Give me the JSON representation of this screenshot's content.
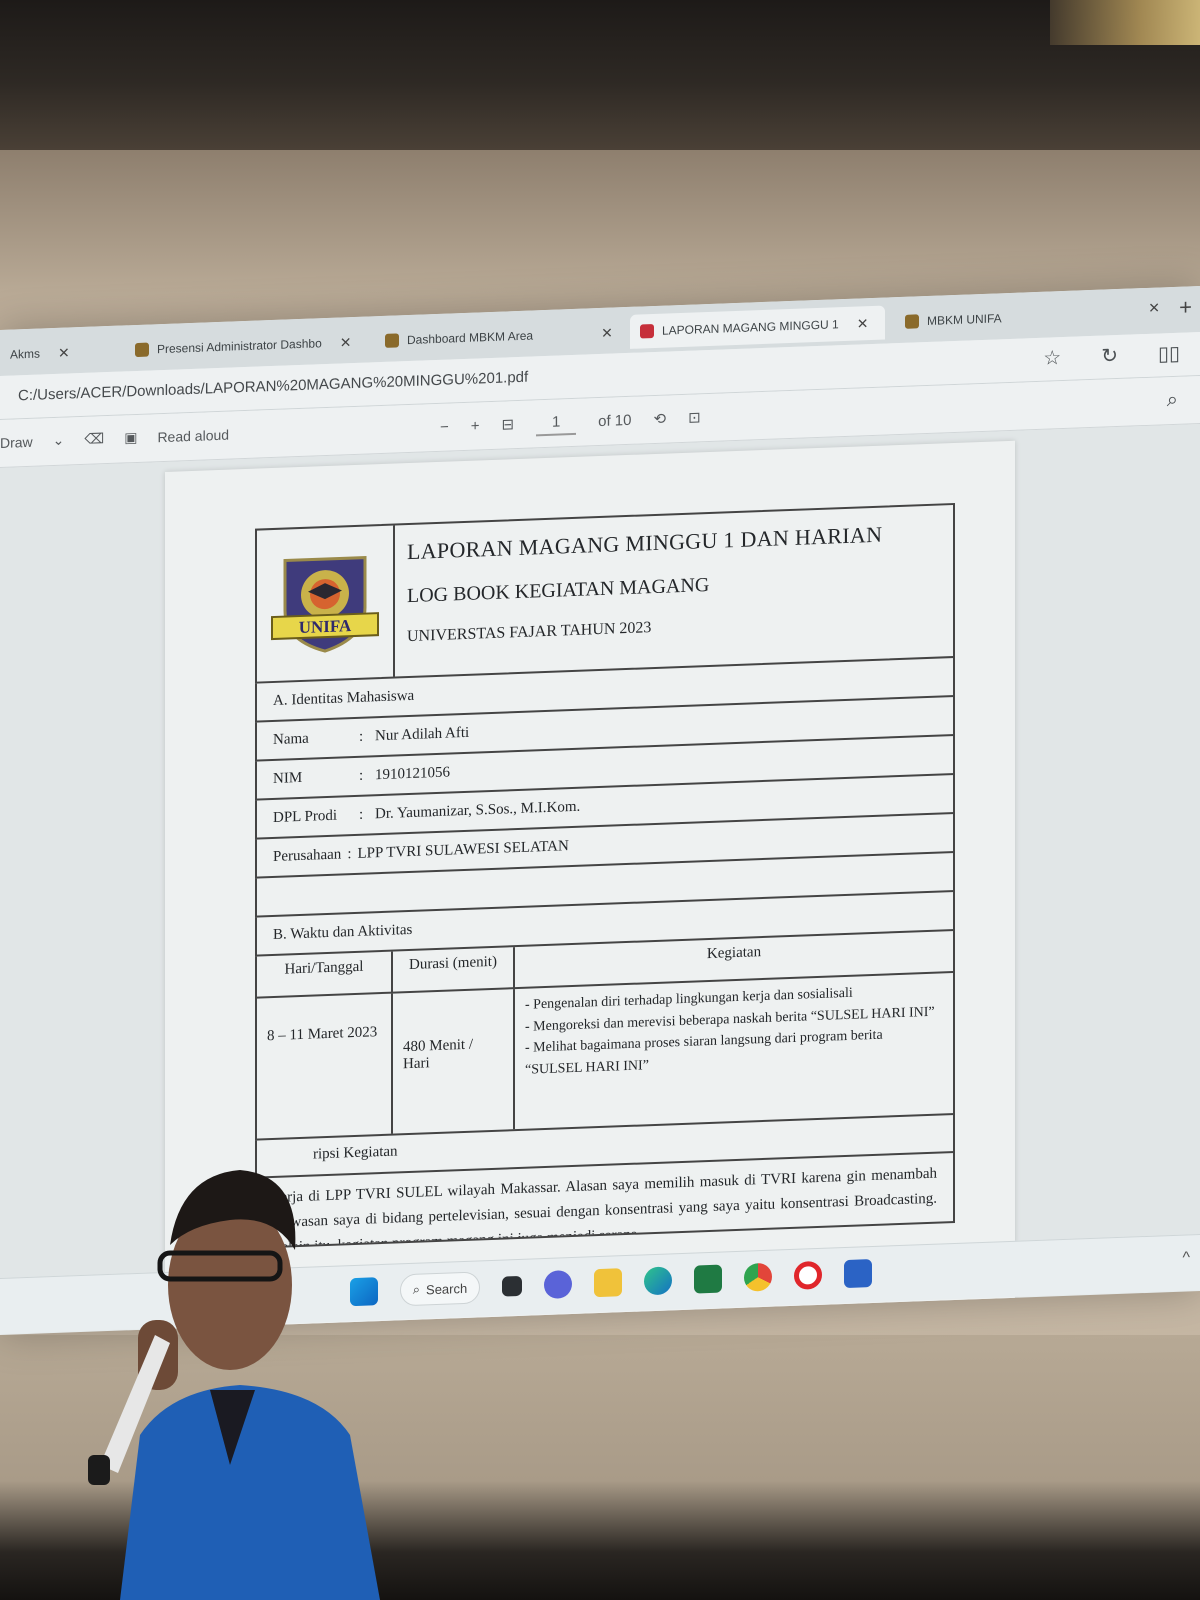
{
  "browser": {
    "tabs": [
      {
        "label": "Akms",
        "active": false
      },
      {
        "label": "Presensi Administrator Dashbo",
        "active": false
      },
      {
        "label": "Dashboard MBKM Area",
        "active": false
      },
      {
        "label": "LAPORAN MAGANG MINGGU 1",
        "active": true
      },
      {
        "label": "MBKM UNIFA",
        "active": false
      }
    ],
    "url": "C:/Users/ACER/Downloads/LAPORAN%20MAGANG%20MINGGU%201.pdf"
  },
  "pdf_toolbar": {
    "draw_label": "Draw",
    "read_aloud_label": "Read aloud",
    "zoom_out": "−",
    "zoom_in": "+",
    "page_current": "1",
    "page_total": "of 10"
  },
  "document": {
    "header": {
      "logo_text": "UNIFA",
      "title": "LAPORAN MAGANG MINGGU 1 DAN HARIAN",
      "subtitle": "LOG BOOK KEGIATAN MAGANG",
      "university": "UNIVERSTAS FAJAR TAHUN 2023"
    },
    "section_a": "A. Identitas Mahasiswa",
    "identity": [
      {
        "label": "Nama",
        "value": "Nur Adilah Afti"
      },
      {
        "label": "NIM",
        "value": "1910121056"
      },
      {
        "label": "DPL Prodi",
        "value": "Dr. Yaumanizar, S.Sos., M.I.Kom."
      }
    ],
    "company_label": "Perusahaan",
    "company_value": "LPP TVRI SULAWESI SELATAN",
    "section_b": "B. Waktu dan Aktivitas",
    "table_headers": [
      "Hari/Tanggal",
      "Durasi (menit)",
      "Kegiatan"
    ],
    "activity_row": {
      "hari": "8 – 11 Maret 2023",
      "durasi": "480 Menit / Hari",
      "kegiatan": [
        "- Pengenalan diri terhadap lingkungan kerja dan sosialisali",
        "- Mengoreksi dan merevisi beberapa naskah berita “SULSEL HARI INI”",
        "- Melihat bagaimana proses siaran langsung dari program berita “SULSEL HARI INI”"
      ]
    },
    "section_c": "ripsi Kegiatan",
    "description": "kerja di LPP TVRI SULEL wilayah Makassar. Alasan saya memilih masuk di TVRI karena gin menambah wawasan saya di bidang pertelevisian, sesuai dengan konsentrasi yang saya yaitu konsentrasi Broadcasting. Selain itu, kegiatan program magang ini juga menjadi sarana"
  },
  "taskbar": {
    "search_label": "Search"
  }
}
